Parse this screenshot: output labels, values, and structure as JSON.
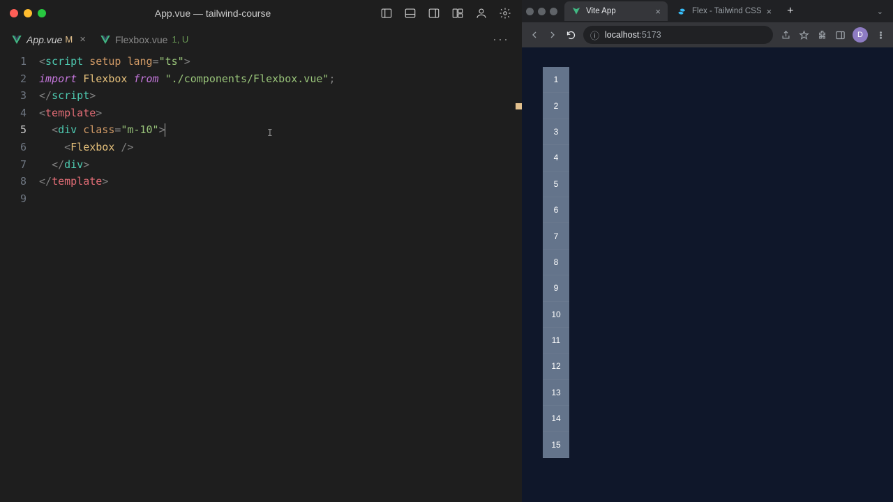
{
  "editor": {
    "window_title": "App.vue — tailwind-course",
    "tabs": [
      {
        "icon": "vue-logo-icon",
        "name": "App.vue",
        "modified_badge": "M",
        "closable": true,
        "active": true
      },
      {
        "icon": "vue-logo-icon",
        "name": "Flexbox.vue",
        "git_badge": "1, U",
        "closable": false,
        "active": false
      }
    ],
    "more_button": "···",
    "active_line": 5,
    "lines": [
      "<script setup lang=\"ts\">",
      "import Flexbox from \"./components/Flexbox.vue\";",
      "</script>",
      "<template>",
      "  <div class=\"m-10\">",
      "    <Flexbox />",
      "  </div>",
      "</template>",
      ""
    ],
    "code_tokens": [
      [
        {
          "t": "<",
          "c": "p"
        },
        {
          "t": "script ",
          "c": "tag"
        },
        {
          "t": "setup ",
          "c": "attr"
        },
        {
          "t": "lang",
          "c": "attr"
        },
        {
          "t": "=",
          "c": "p"
        },
        {
          "t": "\"ts\"",
          "c": "str"
        },
        {
          "t": ">",
          "c": "p"
        }
      ],
      [
        {
          "t": "import ",
          "c": "kw2"
        },
        {
          "t": "Flexbox ",
          "c": "id"
        },
        {
          "t": "from ",
          "c": "kw2"
        },
        {
          "t": "\"./components/Flexbox.vue\"",
          "c": "str"
        },
        {
          "t": ";",
          "c": "p"
        }
      ],
      [
        {
          "t": "</",
          "c": "p"
        },
        {
          "t": "script",
          "c": "tag"
        },
        {
          "t": ">",
          "c": "p"
        }
      ],
      [
        {
          "t": "<",
          "c": "p"
        },
        {
          "t": "template",
          "c": "redtag"
        },
        {
          "t": ">",
          "c": "p"
        }
      ],
      [
        {
          "t": "  ",
          "c": "pl"
        },
        {
          "t": "<",
          "c": "p"
        },
        {
          "t": "div ",
          "c": "tag"
        },
        {
          "t": "class",
          "c": "attr"
        },
        {
          "t": "=",
          "c": "p"
        },
        {
          "t": "\"m-10\"",
          "c": "str"
        },
        {
          "t": ">",
          "c": "p"
        }
      ],
      [
        {
          "t": "    ",
          "c": "pl"
        },
        {
          "t": "<",
          "c": "p"
        },
        {
          "t": "Flexbox ",
          "c": "id"
        },
        {
          "t": "/>",
          "c": "p"
        }
      ],
      [
        {
          "t": "  ",
          "c": "pl"
        },
        {
          "t": "</",
          "c": "p"
        },
        {
          "t": "div",
          "c": "tag"
        },
        {
          "t": ">",
          "c": "p"
        }
      ],
      [
        {
          "t": "</",
          "c": "p"
        },
        {
          "t": "template",
          "c": "redtag"
        },
        {
          "t": ">",
          "c": "p"
        }
      ],
      [
        {
          "t": "",
          "c": "pl"
        }
      ]
    ]
  },
  "browser": {
    "tabs": [
      {
        "favicon": "vite-icon",
        "title": "Vite App",
        "active": true
      },
      {
        "favicon": "tailwind-icon",
        "title": "Flex - Tailwind CSS",
        "active": false
      }
    ],
    "new_tab": "+",
    "url_host": "localhost",
    "url_port": ":5173",
    "avatar_initial": "D"
  },
  "app": {
    "items": [
      "1",
      "2",
      "3",
      "4",
      "5",
      "6",
      "7",
      "8",
      "9",
      "10",
      "11",
      "12",
      "13",
      "14",
      "15"
    ]
  }
}
